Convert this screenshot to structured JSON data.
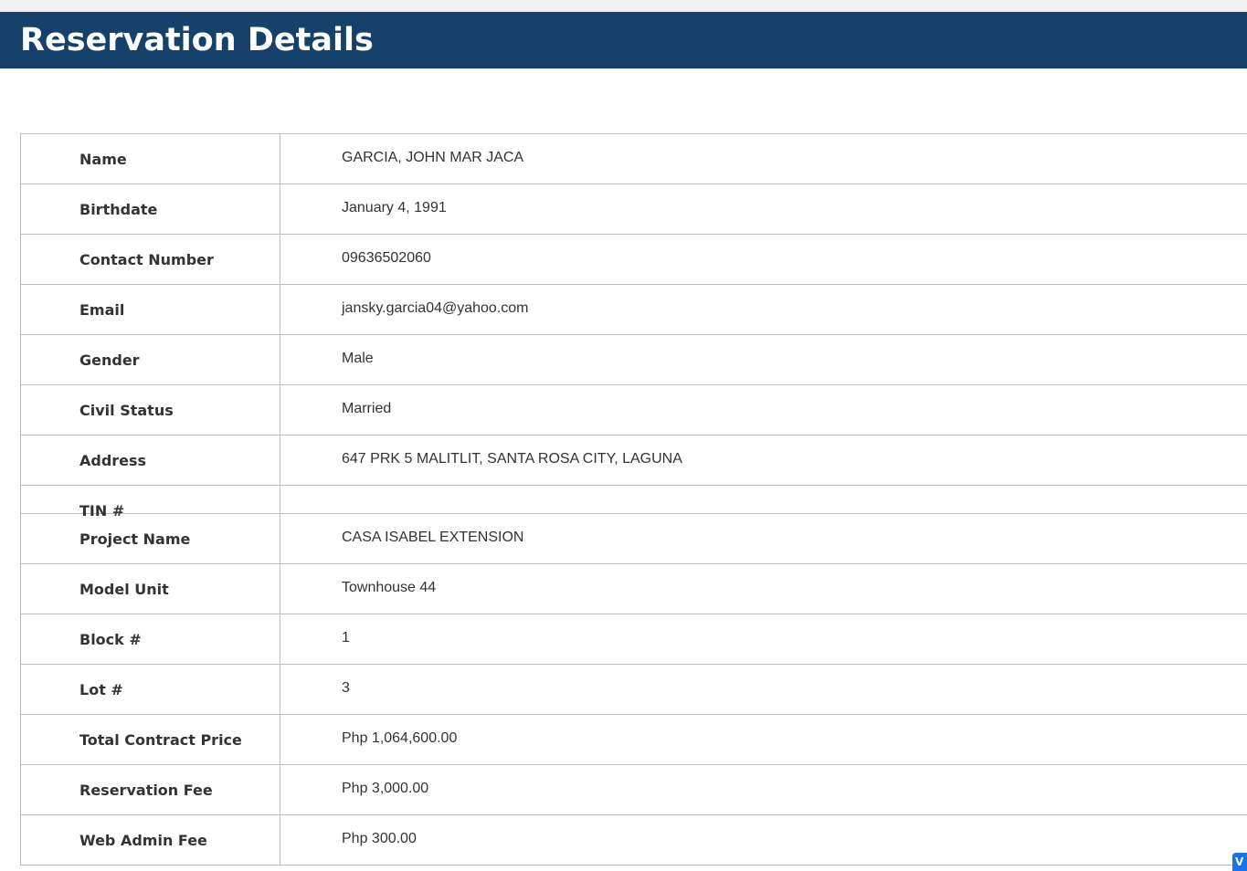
{
  "page": {
    "title": "Reservation Details",
    "accent_color": "#15416b"
  },
  "rows": [
    {
      "label": "Name",
      "value": "GARCIA, JOHN MAR JACA"
    },
    {
      "label": "Birthdate",
      "value": "January 4, 1991"
    },
    {
      "label": "Contact Number",
      "value": "09636502060"
    },
    {
      "label": "Email",
      "value": "jansky.garcia04@yahoo.com"
    },
    {
      "label": "Gender",
      "value": "Male"
    },
    {
      "label": "Civil Status",
      "value": "Married"
    },
    {
      "label": "Address",
      "value": "647 PRK 5 MALITLIT, SANTA ROSA CITY, LAGUNA"
    },
    {
      "label": "TIN #",
      "value": ""
    },
    {
      "label": "Project Name",
      "value": "CASA ISABEL EXTENSION"
    },
    {
      "label": "Model Unit",
      "value": "Townhouse 44"
    },
    {
      "label": "Block #",
      "value": "1"
    },
    {
      "label": "Lot #",
      "value": "3"
    },
    {
      "label": "Total Contract Price",
      "value": "Php 1,064,600.00"
    },
    {
      "label": "Reservation Fee",
      "value": "Php 3,000.00"
    },
    {
      "label": "Web Admin Fee",
      "value": "Php 300.00"
    }
  ],
  "widget": {
    "icon": "chat-widget-icon",
    "glyph": "V"
  }
}
